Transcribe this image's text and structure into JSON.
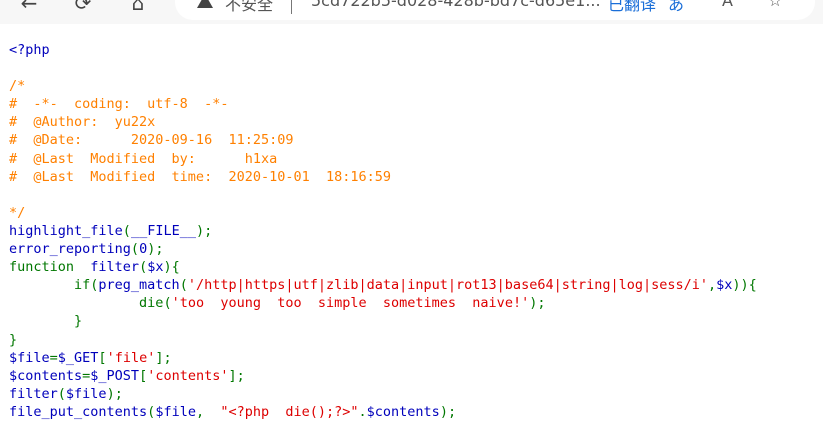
{
  "browser": {
    "security_label": "不安全",
    "url_text": "5cd722b5-d028-428b-bd7c-d65e1...",
    "translate_label": "已翻译"
  },
  "code_lines": [
    [
      {
        "t": "<?php",
        "c": "blue"
      }
    ],
    [],
    [
      {
        "t": "/*",
        "c": "orange"
      }
    ],
    [
      {
        "t": "#  -*-  coding:  utf-8  -*-",
        "c": "orange"
      }
    ],
    [
      {
        "t": "#  @Author:  yu22x",
        "c": "orange"
      }
    ],
    [
      {
        "t": "#  @Date:      2020-09-16  11:25:09",
        "c": "orange"
      }
    ],
    [
      {
        "t": "#  @Last  Modified  by:      h1xa",
        "c": "orange"
      }
    ],
    [
      {
        "t": "#  @Last  Modified  time:  2020-10-01  18:16:59",
        "c": "orange"
      }
    ],
    [],
    [
      {
        "t": "*/",
        "c": "orange"
      }
    ],
    [
      {
        "t": "highlight_file",
        "c": "blue"
      },
      {
        "t": "(",
        "c": "green"
      },
      {
        "t": "__FILE__",
        "c": "blue"
      },
      {
        "t": ");",
        "c": "green"
      }
    ],
    [
      {
        "t": "error_reporting",
        "c": "blue"
      },
      {
        "t": "(",
        "c": "green"
      },
      {
        "t": "0",
        "c": "blue"
      },
      {
        "t": ");",
        "c": "green"
      }
    ],
    [
      {
        "t": "function  ",
        "c": "green"
      },
      {
        "t": "filter",
        "c": "blue"
      },
      {
        "t": "(",
        "c": "green"
      },
      {
        "t": "$x",
        "c": "blue"
      },
      {
        "t": "){",
        "c": "green"
      }
    ],
    [
      {
        "t": "        if(",
        "c": "green"
      },
      {
        "t": "preg_match",
        "c": "blue"
      },
      {
        "t": "(",
        "c": "green"
      },
      {
        "t": "'/http|https|utf|zlib|data|input|rot13|base64|string|log|sess/i'",
        "c": "red"
      },
      {
        "t": ",",
        "c": "green"
      },
      {
        "t": "$x",
        "c": "blue"
      },
      {
        "t": ")){",
        "c": "green"
      }
    ],
    [
      {
        "t": "                ",
        "c": "green"
      },
      {
        "t": "die",
        "c": "green"
      },
      {
        "t": "(",
        "c": "green"
      },
      {
        "t": "'too  young  too  simple  sometimes  naive!'",
        "c": "red"
      },
      {
        "t": ");",
        "c": "green"
      }
    ],
    [
      {
        "t": "        }",
        "c": "green"
      }
    ],
    [
      {
        "t": "}",
        "c": "green"
      }
    ],
    [
      {
        "t": "$file",
        "c": "blue"
      },
      {
        "t": "=",
        "c": "green"
      },
      {
        "t": "$_GET",
        "c": "blue"
      },
      {
        "t": "[",
        "c": "green"
      },
      {
        "t": "'file'",
        "c": "red"
      },
      {
        "t": "];",
        "c": "green"
      }
    ],
    [
      {
        "t": "$contents",
        "c": "blue"
      },
      {
        "t": "=",
        "c": "green"
      },
      {
        "t": "$_POST",
        "c": "blue"
      },
      {
        "t": "[",
        "c": "green"
      },
      {
        "t": "'contents'",
        "c": "red"
      },
      {
        "t": "];",
        "c": "green"
      }
    ],
    [
      {
        "t": "filter",
        "c": "blue"
      },
      {
        "t": "(",
        "c": "green"
      },
      {
        "t": "$file",
        "c": "blue"
      },
      {
        "t": ");",
        "c": "green"
      }
    ],
    [
      {
        "t": "file_put_contents",
        "c": "blue"
      },
      {
        "t": "(",
        "c": "green"
      },
      {
        "t": "$file",
        "c": "blue"
      },
      {
        "t": ",  ",
        "c": "green"
      },
      {
        "t": "\"<?php  die();?>\"",
        "c": "red"
      },
      {
        "t": ".",
        "c": "green"
      },
      {
        "t": "$contents",
        "c": "blue"
      },
      {
        "t": ");",
        "c": "green"
      }
    ]
  ],
  "colors": {
    "blue": "#0000bb",
    "green": "#007700",
    "orange": "#ff8000",
    "red": "#dd0000"
  }
}
